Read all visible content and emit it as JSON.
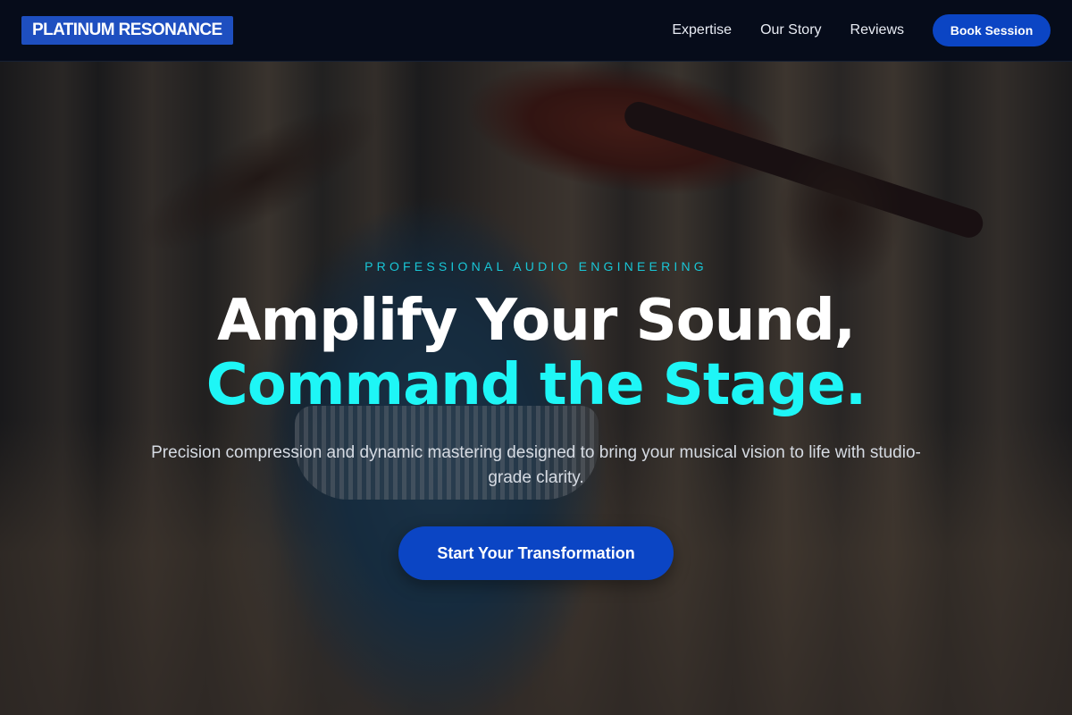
{
  "nav": {
    "logo": "PLATINUM RESONANCE",
    "links": [
      "Expertise",
      "Our Story",
      "Reviews"
    ],
    "cta_label": "Book Session"
  },
  "hero": {
    "eyebrow": "PROFESSIONAL AUDIO ENGINEERING",
    "headline_line1": "Amplify Your Sound,",
    "headline_line2": "Command the Stage.",
    "subtext": "Precision compression and dynamic mastering designed to bring your musical vision to life with studio-grade clarity.",
    "cta_label": "Start Your Transformation",
    "background_image": "violinist-in-forest-photo"
  },
  "colors": {
    "accent_cyan": "#1ef6f6",
    "eyebrow_teal": "#19c6d6",
    "button_blue": "#0b45c4",
    "nav_bg": "#060c1a"
  }
}
